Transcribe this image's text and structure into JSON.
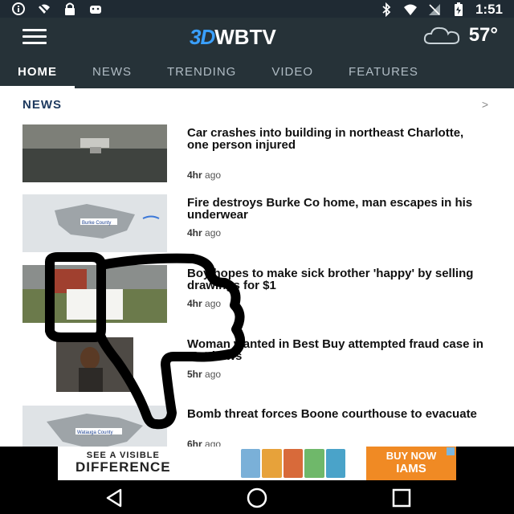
{
  "status_bar": {
    "time": "1:51",
    "left_icons": [
      "info-icon",
      "no-wifi-icon",
      "lock-icon",
      "android-icon"
    ],
    "right_icons": [
      "bluetooth-icon",
      "wifi-icon",
      "no-signal-icon",
      "battery-icon"
    ]
  },
  "header": {
    "logo_mark": "3D",
    "logo_text": "WBTV",
    "weather_icon": "cloud-icon",
    "temperature": "57°"
  },
  "tabs": [
    {
      "label": "HOME",
      "active": true
    },
    {
      "label": "NEWS",
      "active": false
    },
    {
      "label": "TRENDING",
      "active": false
    },
    {
      "label": "VIDEO",
      "active": false
    },
    {
      "label": "FEATURES",
      "active": false
    }
  ],
  "section": {
    "title": "NEWS",
    "more": ">"
  },
  "stories": [
    {
      "headline": "Car crashes into building in northeast Charlotte, one person injured",
      "age_num": "4hr",
      "age_word": "ago"
    },
    {
      "headline": "Fire destroys Burke Co home, man escapes in his underwear",
      "age_num": "4hr",
      "age_word": "ago",
      "map_label": "Burke County"
    },
    {
      "headline": "Boy hopes to make sick brother 'happy' by selling drawings for $1",
      "age_num": "4hr",
      "age_word": "ago"
    },
    {
      "headline": "Woman wanted in Best Buy attempted fraud case in Matthews",
      "age_num": "5hr",
      "age_word": "ago"
    },
    {
      "headline": "Bomb threat forces Boone courthouse to evacuate",
      "age_num": "6hr",
      "age_word": "ago",
      "map_label": "Watauga County"
    }
  ],
  "ad": {
    "line1": "SEE A VISIBLE",
    "line2": "DIFFERENCE",
    "cta": "BUY NOW",
    "brand": "IAMS",
    "brand_color": "#f08a24"
  },
  "colors": {
    "status_bar": "#1f2a33",
    "app_bar": "#263238",
    "section_title": "#1e3a5f",
    "logo_accent": "#3aa0ff"
  }
}
